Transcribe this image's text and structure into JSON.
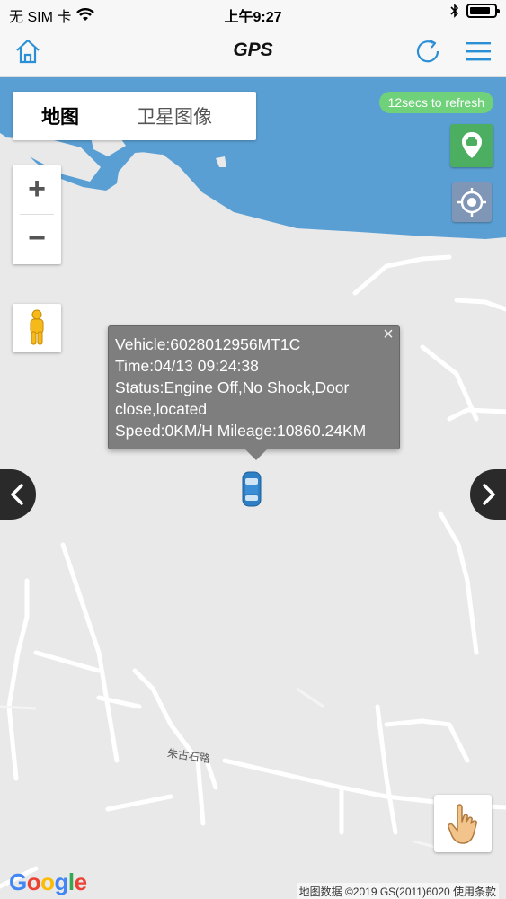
{
  "status_bar": {
    "carrier": "无 SIM 卡",
    "time": "上午9:27"
  },
  "nav": {
    "title": "GPS",
    "home_icon": "home-icon",
    "refresh_icon": "refresh-icon",
    "menu_icon": "hamburger-menu-icon"
  },
  "map_type": {
    "map_label": "地图",
    "satellite_label": "卫星图像"
  },
  "refresh_badge": "12secs to refresh",
  "zoom": {
    "in_label": "+",
    "out_label": "−"
  },
  "info_window": {
    "vehicle": "Vehicle:6028012956MT1C",
    "time": "Time:04/13 09:24:38",
    "status": "Status:Engine Off,No Shock,Door close,located",
    "speed_mileage": "Speed:0KM/H Mileage:10860.24KM",
    "close": "×"
  },
  "map_labels": {
    "road": "朱古石路",
    "attribution": "地图数据 ©2019 GS(2011)6020 使用条款",
    "google": "Google"
  },
  "colors": {
    "water": "#5a9fd4",
    "land": "#e9e9e9",
    "refresh_badge": "#6fd17a",
    "location_button": "#4cae60",
    "target_button": "#7f96b6",
    "info_window": "#7e7e7e",
    "nav_accent": "#2b8fd6"
  }
}
